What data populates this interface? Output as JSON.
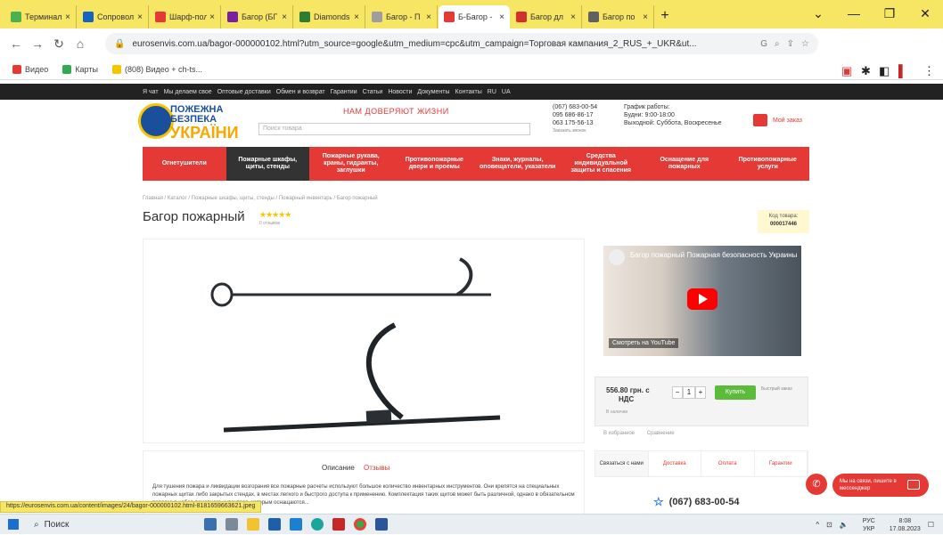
{
  "browser": {
    "tabs": [
      {
        "label": "Терминал",
        "color": "#4caf50"
      },
      {
        "label": "Сопровол",
        "color": "#1565c0"
      },
      {
        "label": "Шарф-пол",
        "color": "#e53935"
      },
      {
        "label": "Багор (БГ",
        "color": "#7b1fa2"
      },
      {
        "label": "Diamonds",
        "color": "#2e7d32"
      },
      {
        "label": "Багор - П",
        "color": "#9e9e9e"
      },
      {
        "label": "Б-Багор -",
        "color": "#e53935"
      },
      {
        "label": "Багор дл",
        "color": "#d32f2f"
      },
      {
        "label": "Багор по",
        "color": "#616161"
      }
    ],
    "active_tab": 6,
    "url": "eurosenvis.com.ua/bagor-000000102.html?utm_source=google&utm_medium=cpc&utm_campaign=Торговая кампания_2_RUS_+_UKR&ut...",
    "bookmarks": [
      "Видео",
      "Карты",
      "(808) Видео + ch-ts..."
    ],
    "status_url": "https://eurosenvis.com.ua/content/images/24/bagor-000000102.html-8181659663621.jpeg"
  },
  "site": {
    "topnav": [
      "Я чат",
      "Мы делаем свое",
      "Оптовые доставки",
      "Обмен и возврат",
      "Гарантии",
      "Статьи",
      "Новости",
      "Документы",
      "Контакты",
      "RU",
      "UA"
    ],
    "logo": {
      "line1": "ПОЖЕЖНА",
      "line2": "БЕЗПЕКА",
      "line3": "УКРАЇНИ"
    },
    "slogan": "НАМ ДОВЕРЯЮТ ЖИЗНИ",
    "search_placeholder": "Поиск товара",
    "phones": [
      "(067) 683-00-54",
      "095 686-86-17",
      "063 175-56-13",
      "Заказать звонок"
    ],
    "hours": [
      "График работы:",
      "Будни: 9:00-18:00",
      "Выходной: Суббота, Воскресенье"
    ],
    "cart_label": "Мой заказ",
    "menu": [
      "Огнетушители",
      "Пожарные шкафы, щиты, стенды",
      "Пожарные рукава, краны, гидранты, заглушки",
      "Противопожарные двери и проемы",
      "Знаки, журналы, оповещатели, указатели",
      "Средства индивидуальной защиты и спасения",
      "Оснащение для пожарных",
      "Противопожарные услуги"
    ],
    "active_menu": 1
  },
  "product": {
    "breadcrumbs": "Главная / Каталог / Пожарные шкафы, щиты, стенды / Пожарный инвентарь / Багор пожарный",
    "title": "Багор пожарный",
    "stars": "★★★★★",
    "reviews_small": "0 отзывов",
    "code_label": "Код товара:",
    "code_value": "000017446",
    "video_title": "Багор пожарный Пожарная безопасность Украины",
    "video_brand": "Смотреть на YouTube",
    "price": "556.80 грн. с",
    "price_vat": "НДС",
    "qty": "1",
    "buy_label": "Купить",
    "fast_order": "Быстрый заказ",
    "availability": "В наличии",
    "compare": [
      "В избранное",
      "Сравнение"
    ],
    "desc_tabs": [
      "Описание",
      "Отзывы"
    ],
    "desc_text": "Для тушения пожара и ликвидации возгорания все пожарные расчеты используют большое количество инвентарных инструментов. Они крепятся на специальных пожарных щитах либо закрытых стендах, в местах легкого и быстрого доступа к применению. Комплектация таких щитов может быть различной, однако в обязательном порядке в набор пожарного инвентаря, которым оснащаются...",
    "side_tabs": [
      "Связаться с нами",
      "Доставка",
      "Оплата",
      "Гарантии"
    ],
    "big_phone": "(067) 683-00-54",
    "chat_text": "Мы на связи, пишите в мессенджер"
  },
  "taskbar": {
    "search": "Поиск",
    "lang": "РУС",
    "lang2": "УКР",
    "time": "8:08",
    "date": "17.08.2023"
  }
}
